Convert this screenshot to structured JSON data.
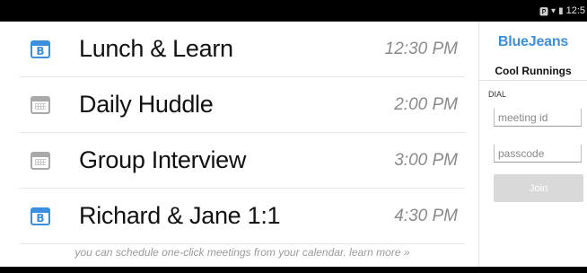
{
  "status_bar": {
    "icons": [
      "bluetooth-icon",
      "wifi-icon",
      "battery-icon"
    ],
    "time": "12:5"
  },
  "meetings": [
    {
      "title": "Lunch & Learn",
      "time": "12:30 PM",
      "icon": "bluejeans-calendar-icon"
    },
    {
      "title": "Daily Huddle",
      "time": "2:00 PM",
      "icon": "calendar-icon"
    },
    {
      "title": "Group Interview",
      "time": "3:00 PM",
      "icon": "calendar-icon"
    },
    {
      "title": "Richard & Jane 1:1",
      "time": "4:30 PM",
      "icon": "bluejeans-calendar-icon"
    }
  ],
  "bj_icon_letter": "B",
  "footer_note": "you can schedule one-click meetings from your calendar. learn more »",
  "panel": {
    "brand": "BlueJeans",
    "user_name": "Cool Runnings",
    "dial_label": "DIAL",
    "meeting_id_placeholder": "meeting id",
    "passcode_placeholder": "passcode",
    "join_label": "Join"
  },
  "colors": {
    "accent": "#3a8fde",
    "join_disabled": "#d9d9d9"
  }
}
